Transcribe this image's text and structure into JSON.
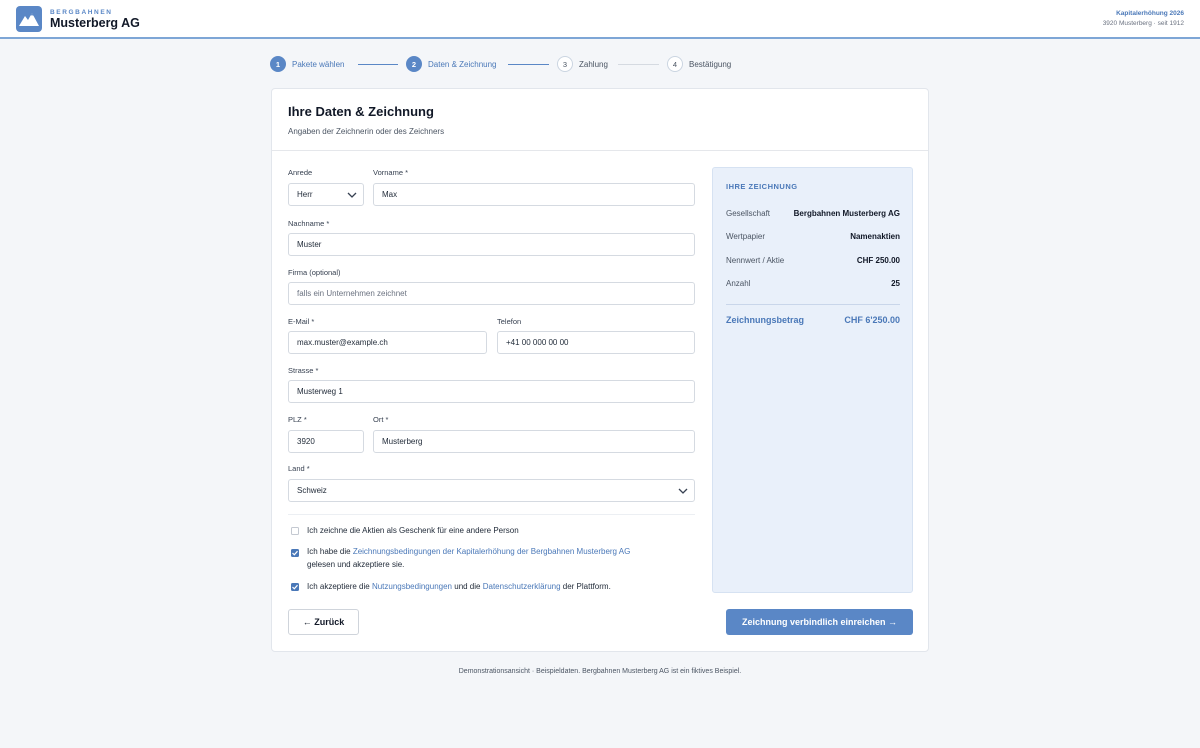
{
  "header": {
    "brand_small": "BERGBAHNEN",
    "brand_name": "Musterberg AG",
    "campaign": "Kapitalerhöhung 2026",
    "meta": "3920 Musterberg · seit 1912"
  },
  "stepper": {
    "steps": [
      {
        "num": "1",
        "label": "Pakete wählen",
        "state": "done"
      },
      {
        "num": "2",
        "label": "Daten & Zeichnung",
        "state": "active"
      },
      {
        "num": "3",
        "label": "Zahlung",
        "state": "inactive"
      },
      {
        "num": "4",
        "label": "Bestätigung",
        "state": "inactive"
      }
    ]
  },
  "form": {
    "title": "Ihre Daten & Zeichnung",
    "subtitle": "Angaben der Zeichnerin oder des Zeichners",
    "anrede": {
      "label": "Anrede",
      "value": "Herr"
    },
    "vorname": {
      "label": "Vorname *",
      "value": "Max"
    },
    "nachname": {
      "label": "Nachname *",
      "value": "Muster"
    },
    "firma": {
      "label": "Firma (optional)",
      "placeholder": "falls ein Unternehmen zeichnet"
    },
    "email": {
      "label": "E-Mail *",
      "value": "max.muster@example.ch"
    },
    "telefon": {
      "label": "Telefon",
      "value": "+41 00 000 00 00"
    },
    "strasse": {
      "label": "Strasse *",
      "value": "Musterweg 1"
    },
    "plz": {
      "label": "PLZ *",
      "value": "3920"
    },
    "ort": {
      "label": "Ort *",
      "value": "Musterberg"
    },
    "land": {
      "label": "Land *",
      "value": "Schweiz"
    },
    "checks": {
      "gift": {
        "checked": false,
        "text": "Ich zeichne die Aktien als Geschenk für eine andere Person"
      },
      "terms": {
        "checked": true,
        "pre": "Ich habe die ",
        "link": "Zeichnungsbedingungen der Kapitalerhöhung der Bergbahnen Musterberg AG",
        "post": "gelesen und akzeptiere sie."
      },
      "privacy": {
        "checked": true,
        "pre": "Ich akzeptiere die ",
        "link1": "Nutzungsbedingungen",
        "mid": " und die ",
        "link2": "Datenschutzerklärung",
        "post": " der Plattform."
      }
    },
    "back_label": "← Zurück",
    "submit_label": "Zeichnung verbindlich einreichen →"
  },
  "summary": {
    "title": "IHRE ZEICHNUNG",
    "rows": [
      {
        "key": "Gesellschaft",
        "value": "Bergbahnen Musterberg AG"
      },
      {
        "key": "Wertpapier",
        "value": "Namenaktien"
      },
      {
        "key": "Nennwert / Aktie",
        "value": "CHF 250.00"
      },
      {
        "key": "Anzahl",
        "value": "25"
      }
    ],
    "total_key": "Zeichnungsbetrag",
    "total_value": "CHF 6'250.00"
  },
  "footer": "Demonstrationsansicht · Beispieldaten. Bergbahnen Musterberg AG ist ein fiktives Beispiel.",
  "colors": {
    "accent": "#5a87c6",
    "link": "#4a78b8",
    "summary_bg": "#e9f0fa"
  }
}
